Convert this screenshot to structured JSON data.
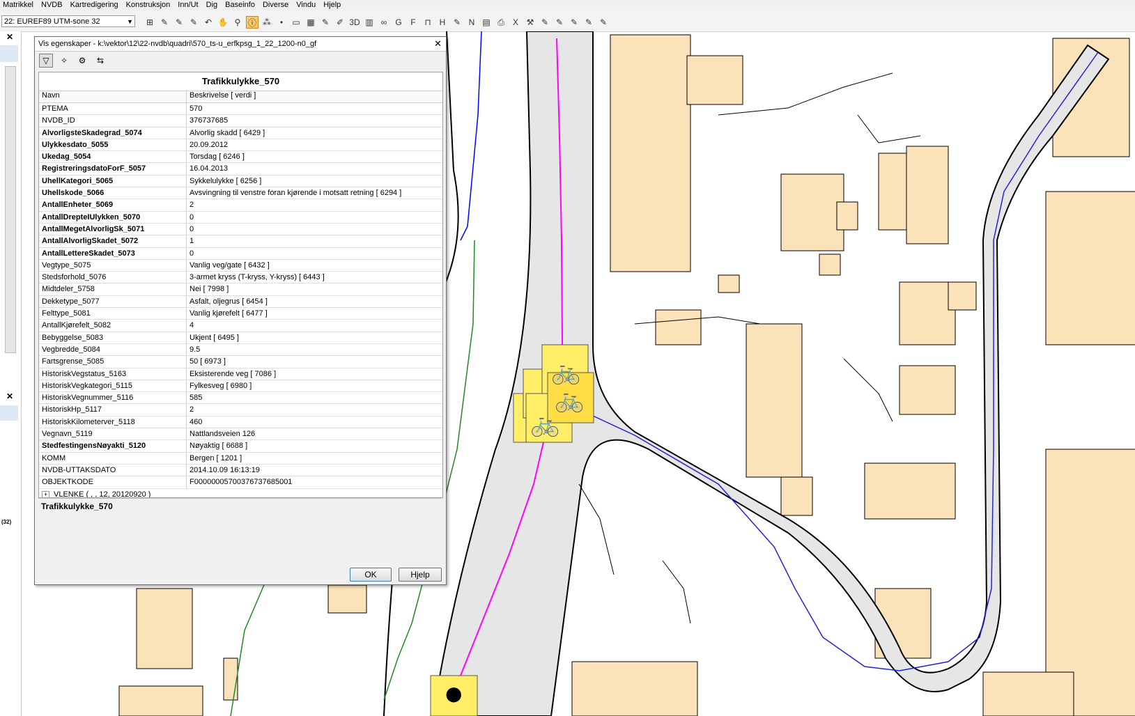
{
  "menubar": [
    "Matrikkel",
    "NVDB",
    "Kartredigering",
    "Konstruksjon",
    "Inn/Ut",
    "Dig",
    "Baseinfo",
    "Diverse",
    "Vindu",
    "Hjelp"
  ],
  "toolbar": {
    "crs_selected": "22: EUREF89 UTM-sone 32",
    "icons": [
      "grid-icon",
      "tool-icon",
      "tool-icon",
      "tool-icon",
      "undo-icon",
      "pan-hand-icon",
      "zoom-icon",
      "info-icon",
      "network-icon",
      "point-icon",
      "ruler-icon",
      "table-icon",
      "tool-icon",
      "edit-icon",
      "3d-icon",
      "stats-icon",
      "binoculars-icon",
      "gid-icon",
      "fig-icon",
      "gate-icon",
      "hp-icon",
      "tool-icon",
      "nvdb-icon",
      "book-icon",
      "print-icon",
      "excel-icon",
      "crane-icon",
      "tool-icon",
      "tool-icon",
      "tool-icon",
      "tool-icon",
      "tool-icon"
    ]
  },
  "leftstrip": {
    "close1": "✕",
    "close2": "✕",
    "label_32": "(32)"
  },
  "dialog": {
    "title": "Vis egenskaper - k:\\vektor\\12\\22-nvdb\\quadri\\570_ts-u_erfkpsg_1_22_1200-n0_gf",
    "object_title": "Trafikkulykke_570",
    "col_name": "Navn",
    "col_desc": "Beskrivelse [ verdi ]",
    "rows": [
      {
        "name": "PTEMA",
        "value": "570",
        "bold": false
      },
      {
        "name": "NVDB_ID",
        "value": "376737685",
        "bold": false
      },
      {
        "name": "AlvorligsteSkadegrad_5074",
        "value": "Alvorlig skadd [ 6429 ]",
        "bold": true
      },
      {
        "name": "Ulykkesdato_5055",
        "value": "20.09.2012",
        "bold": true
      },
      {
        "name": "Ukedag_5054",
        "value": "Torsdag [ 6246 ]",
        "bold": true
      },
      {
        "name": "RegistreringsdatoForF_5057",
        "value": "16.04.2013",
        "bold": true
      },
      {
        "name": "UhellKategori_5065",
        "value": "Sykkelulykke [ 6256 ]",
        "bold": true
      },
      {
        "name": "Uhellskode_5066",
        "value": "Avsvingning til venstre foran kjørende i motsatt retning [ 6294 ]",
        "bold": true
      },
      {
        "name": "AntallEnheter_5069",
        "value": "2",
        "bold": true
      },
      {
        "name": "AntallDrepteIUlykken_5070",
        "value": "0",
        "bold": true
      },
      {
        "name": "AntallMegetAlvorligSk_5071",
        "value": "0",
        "bold": true
      },
      {
        "name": "AntallAlvorligSkadet_5072",
        "value": "1",
        "bold": true
      },
      {
        "name": "AntallLettereSkadet_5073",
        "value": "0",
        "bold": true
      },
      {
        "name": "Vegtype_5075",
        "value": "Vanlig veg/gate [ 6432 ]",
        "bold": false
      },
      {
        "name": "Stedsforhold_5076",
        "value": "3-armet kryss (T-kryss, Y-kryss) [ 6443 ]",
        "bold": false
      },
      {
        "name": "Midtdeler_5758",
        "value": "Nei [ 7998 ]",
        "bold": false
      },
      {
        "name": "Dekketype_5077",
        "value": "Asfalt, oljegrus [ 6454 ]",
        "bold": false
      },
      {
        "name": "Felttype_5081",
        "value": "Vanlig kjørefelt [ 6477 ]",
        "bold": false
      },
      {
        "name": "AntallKjørefelt_5082",
        "value": "4",
        "bold": false
      },
      {
        "name": "Bebyggelse_5083",
        "value": "Ukjent [ 6495 ]",
        "bold": false
      },
      {
        "name": "Vegbredde_5084",
        "value": "9.5",
        "bold": false
      },
      {
        "name": "Fartsgrense_5085",
        "value": "50 [ 6973 ]",
        "bold": false
      },
      {
        "name": "HistoriskVegstatus_5163",
        "value": "Eksisterende veg [ 7086 ]",
        "bold": false
      },
      {
        "name": "HistoriskVegkategori_5115",
        "value": "Fylkesveg [ 6980 ]",
        "bold": false
      },
      {
        "name": "HistoriskVegnummer_5116",
        "value": "585",
        "bold": false
      },
      {
        "name": "HistoriskHp_5117",
        "value": "2",
        "bold": false
      },
      {
        "name": "HistoriskKilometerver_5118",
        "value": "460",
        "bold": false
      },
      {
        "name": "Vegnavn_5119",
        "value": "Nattlandsveien 126",
        "bold": false
      },
      {
        "name": "StedfestingensNøyakti_5120",
        "value": "Nøyaktig [ 6688 ]",
        "bold": true
      },
      {
        "name": "KOMM",
        "value": "Bergen [ 1201 ]",
        "bold": false
      },
      {
        "name": "NVDB-UTTAKSDATO",
        "value": "2014.10.09 16:13:19",
        "bold": false
      },
      {
        "name": "OBJEKTKODE",
        "value": "F00000005700376737685001",
        "bold": false
      }
    ],
    "vlenke": "VLENKE ( , , 12, 20120920 )",
    "description": "Trafikkulykke_570",
    "ok_label": "OK",
    "help_label": "Hjelp"
  }
}
